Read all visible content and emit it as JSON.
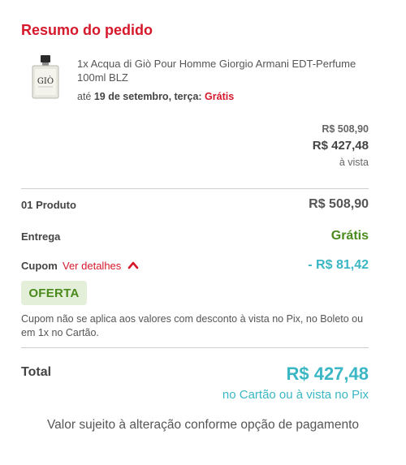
{
  "summary": {
    "title": "Resumo do pedido"
  },
  "product": {
    "name": "1x Acqua di Giò Pour Homme Giorgio Armani EDT-Perfume 100ml BLZ",
    "delivery_prefix": "até ",
    "delivery_date": "19 de setembro, terça:",
    "delivery_free": "Grátis",
    "bottle_text": "GIÒ",
    "price_original": "R$ 508,90",
    "price_current": "R$ 427,48",
    "price_note": "à vista"
  },
  "totals": {
    "products_label": "01 Produto",
    "products_value": "R$ 508,90",
    "delivery_label": "Entrega",
    "delivery_value": "Grátis",
    "coupon_label": "Cupom",
    "coupon_link": "Ver detalhes",
    "coupon_value": "- R$ 81,42",
    "coupon_code": "OFERTA",
    "coupon_note": "Cupom não se aplica aos valores com desconto à vista no Pix, no Boleto ou em 1x no Cartão.",
    "total_label": "Total",
    "total_value": "R$ 427,48",
    "total_sub": "no Cartão ou à vista no Pix"
  },
  "footer": {
    "text": "Valor sujeito à alteração conforme opção de pagamento"
  },
  "colors": {
    "brand_red": "#d6182b",
    "green": "#4a8a1c",
    "teal": "#3ab6c4"
  },
  "icons": {
    "coupon_toggle": "chevron-up-icon",
    "product_image": "perfume-bottle-image"
  }
}
